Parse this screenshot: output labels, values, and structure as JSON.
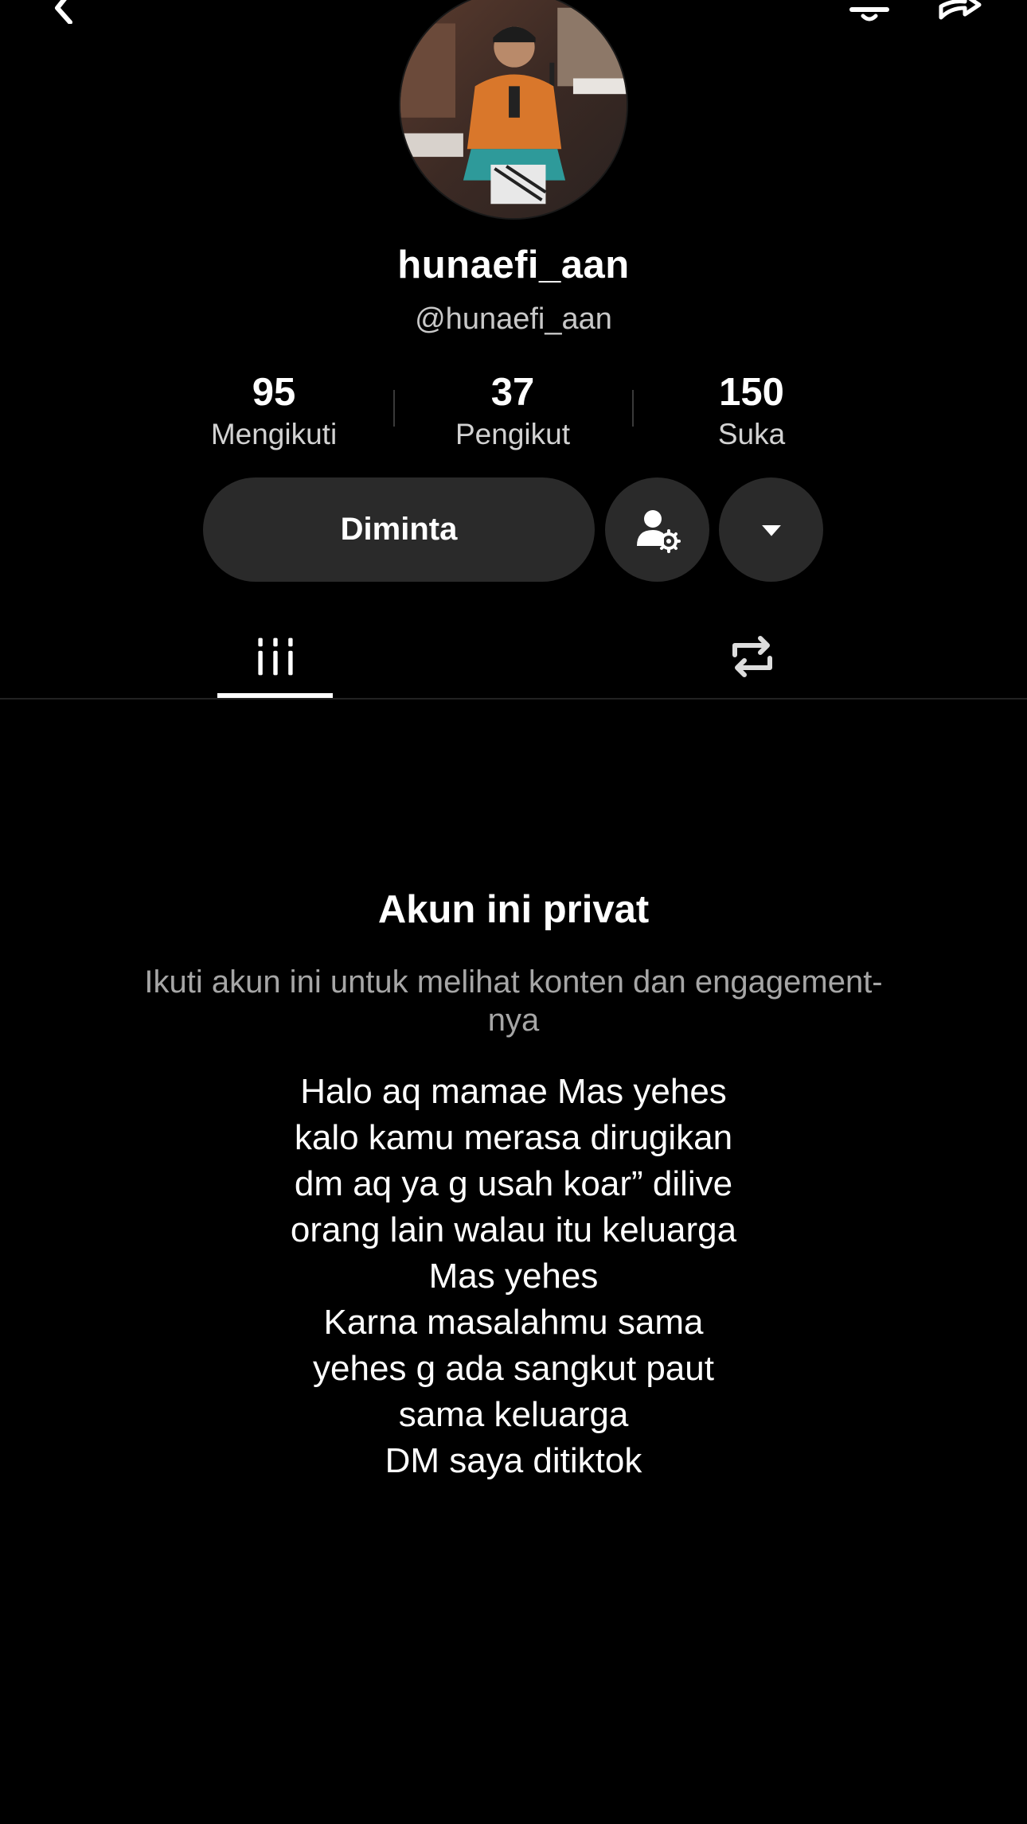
{
  "header": {
    "back_icon": "chevron-left-icon",
    "notification_icon": "bell-icon",
    "share_icon": "share-arrow-icon"
  },
  "profile": {
    "display_name": "hunaefi_aan",
    "handle": "@hunaefi_aan",
    "avatar_icon": "profile-photo"
  },
  "stats": {
    "following": {
      "value": "95",
      "label": "Mengikuti"
    },
    "followers": {
      "value": "37",
      "label": "Pengikut"
    },
    "likes": {
      "value": "150",
      "label": "Suka"
    }
  },
  "actions": {
    "requested_label": "Diminta",
    "user_settings_icon": "user-gear-icon",
    "dropdown_icon": "caret-down-icon"
  },
  "tabs": [
    {
      "name": "videos",
      "icon": "grid-bars-icon",
      "active": true
    },
    {
      "name": "reposts",
      "icon": "repost-icon",
      "active": false
    }
  ],
  "private_notice": {
    "title": "Akun ini privat",
    "description_line1": "Ikuti akun ini untuk melihat konten dan engagement-",
    "description_line2": "nya"
  },
  "bio": {
    "lines": [
      "Halo aq mamae Mas yehes",
      "kalo kamu merasa dirugikan",
      "dm aq ya g usah koar” dilive",
      "orang lain walau itu keluarga",
      "Mas yehes",
      "Karna masalahmu sama",
      "yehes g ada sangkut paut",
      "sama keluarga",
      "DM saya ditiktok"
    ]
  },
  "colors": {
    "background": "#000000",
    "button_bg": "#2a2a2a",
    "secondary_text": "#a6a6a6",
    "primary_text": "#ffffff"
  }
}
